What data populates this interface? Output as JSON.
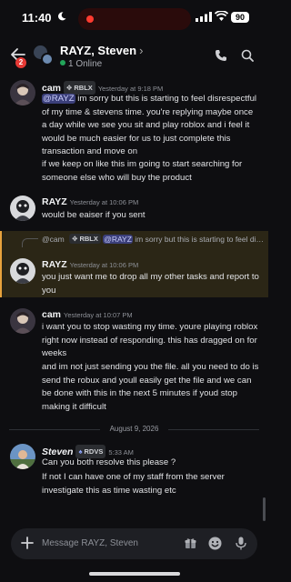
{
  "status_bar": {
    "time": "11:40",
    "battery": "90"
  },
  "header": {
    "unread_count": "2",
    "title": "RAYZ, Steven",
    "chevron": "›",
    "online": "1 Online"
  },
  "messages": [
    {
      "author": "cam",
      "tag": "RBLX",
      "timestamp": "Yesterday at 9:18 PM",
      "mention": "@RAYZ",
      "text": " im sorry but this is starting to feel disrespectful of my time & stevens time. you're replying maybe once a day while we see you sit and play roblox and i feel it would be much easier for us to just complete this transaction and move on",
      "text2": "if we keep on like this im going to start searching for someone else who will buy the product"
    },
    {
      "author": "RAYZ",
      "timestamp": "Yesterday at 10:06 PM",
      "text": "would be eaiser if you sent"
    },
    {
      "reply_author": "@cam",
      "reply_tag": "RBLX",
      "reply_mention": "@RAYZ",
      "reply_text": "im sorry but this is starting to feel disrespectful of my time & stevens time. you're replyi...",
      "author": "RAYZ",
      "timestamp": "Yesterday at 10:06 PM",
      "text": "you just want me to drop all my other tasks and report to you"
    },
    {
      "author": "cam",
      "timestamp": "Yesterday at 10:07 PM",
      "text": "i want you to stop wasting my time. youre playing roblox right now instead of responding. this has dragged on for weeks",
      "text2": "and im not just sending you the file. all you need to do is send the robux and youll easily get the file and we can be done with this in the next 5 minutes if youd stop making it difficult"
    },
    {
      "author": "Steven",
      "tag": "RDVS",
      "timestamp": "5:33 AM",
      "text": "Can you both resolve this please ?",
      "text2": "If not I can have one of my staff from the server investigate this as time wasting etc"
    }
  ],
  "date_divider": "August 9, 2026",
  "composer": {
    "placeholder": "Message RAYZ, Steven"
  },
  "colors": {
    "background": "#0e0e11",
    "mention_bg": "#3b3f7a",
    "highlight_bar": "#e8a33d",
    "online": "#23a55a",
    "badge": "#e53935"
  },
  "icons": [
    "moon-icon",
    "record-icon",
    "signal-icon",
    "wifi-icon",
    "back-arrow-icon",
    "call-icon",
    "search-icon",
    "plus-icon",
    "gift-icon",
    "emoji-icon",
    "mic-icon"
  ]
}
